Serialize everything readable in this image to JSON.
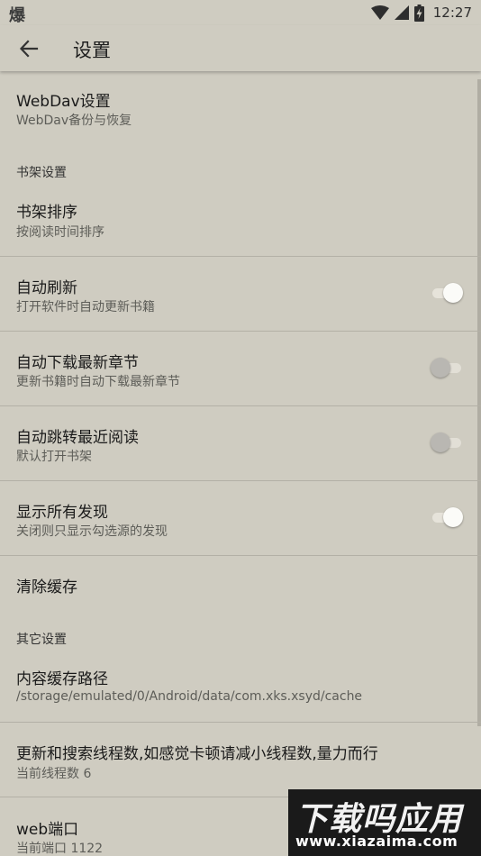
{
  "status_bar": {
    "app_glyph": "爆",
    "time": "12:27"
  },
  "app_bar": {
    "title": "设置"
  },
  "preferences": {
    "webdav": {
      "title": "WebDav设置",
      "summary": "WebDav备份与恢复"
    },
    "bookshelf_category": "书架设置",
    "bookshelf_sort": {
      "title": "书架排序",
      "summary": "按阅读时间排序"
    },
    "auto_refresh": {
      "title": "自动刷新",
      "summary": "打开软件时自动更新书籍",
      "on": true
    },
    "auto_download": {
      "title": "自动下载最新章节",
      "summary": "更新书籍时自动下载最新章节",
      "on": false
    },
    "auto_jump": {
      "title": "自动跳转最近阅读",
      "summary": "默认打开书架",
      "on": false
    },
    "show_all_find": {
      "title": "显示所有发现",
      "summary": "关闭则只显示勾选源的发现",
      "on": true
    },
    "clear_cache": {
      "title": "清除缓存"
    },
    "other_category": "其它设置",
    "cache_path": {
      "title": "内容缓存路径",
      "summary": "/storage/emulated/0/Android/data/com.xks.xsyd/cache"
    },
    "threads": {
      "title": "更新和搜索线程数,如感觉卡顿请减小线程数,量力而行",
      "summary": "当前线程数 6"
    },
    "web_port": {
      "title": "web端口",
      "summary": "当前端口 1122"
    }
  },
  "watermark": {
    "main": "下载吗应用",
    "sub": "www.xiazaima.com"
  },
  "colors": {
    "background": "#cfccc1",
    "divider": "#b3b0a6",
    "switch_thumb_on": "#fbfbf8",
    "switch_thumb_off": "#b9b7b2"
  }
}
